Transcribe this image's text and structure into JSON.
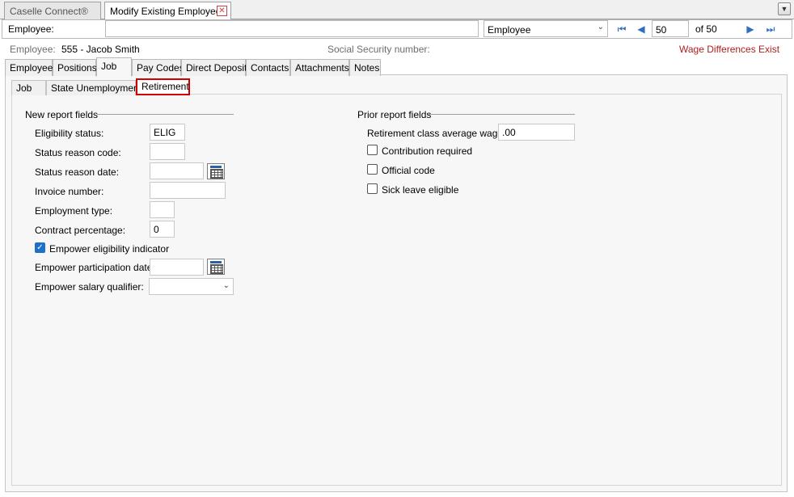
{
  "doc_tabs": [
    {
      "label": "Caselle Connect®"
    },
    {
      "label": "Modify Existing Employees"
    }
  ],
  "employee_bar": {
    "label": "Employee:",
    "search_value": "",
    "lookup_type": "Employee",
    "record_number": "50",
    "record_total": "of 50"
  },
  "info": {
    "employee_label": "Employee:",
    "employee_value": "555 - Jacob Smith",
    "ssn_label": "Social Security number:",
    "warning": "Wage Differences Exist"
  },
  "main_tabs": [
    {
      "label": "Employee"
    },
    {
      "label": "Positions"
    },
    {
      "label": "Job"
    },
    {
      "label": "Pay Codes"
    },
    {
      "label": "Direct Deposit"
    },
    {
      "label": "Contacts"
    },
    {
      "label": "Attachments"
    },
    {
      "label": "Notes"
    }
  ],
  "sub_tabs": [
    {
      "label": "Job"
    },
    {
      "label": "State Unemployment"
    },
    {
      "label": "Retirement"
    }
  ],
  "new_report": {
    "title": "New report fields",
    "eligibility_status": {
      "label": "Eligibility status:",
      "value": "ELIG"
    },
    "status_reason_code": {
      "label": "Status reason code:",
      "value": ""
    },
    "status_reason_date": {
      "label": "Status reason date:",
      "value": ""
    },
    "invoice_number": {
      "label": "Invoice number:",
      "value": ""
    },
    "employment_type": {
      "label": "Employment type:",
      "value": ""
    },
    "contract_percentage": {
      "label": "Contract percentage:",
      "value": "0"
    },
    "empower_eligibility": {
      "label": "Empower eligibility indicator",
      "checked": true
    },
    "empower_participation_date": {
      "label": "Empower participation date:",
      "value": ""
    },
    "empower_salary_qualifier": {
      "label": "Empower salary qualifier:",
      "value": ""
    }
  },
  "prior_report": {
    "title": "Prior report fields",
    "class_avg_wage": {
      "label": "Retirement class average wage:",
      "value": ".00"
    },
    "contribution_required": {
      "label": "Contribution required",
      "checked": false
    },
    "official_code": {
      "label": "Official code",
      "checked": false
    },
    "sick_leave_eligible": {
      "label": "Sick leave eligible",
      "checked": false
    }
  },
  "colors": {
    "warning": "#b02020",
    "selected_outline": "#d00000",
    "accent": "#2070c8"
  }
}
